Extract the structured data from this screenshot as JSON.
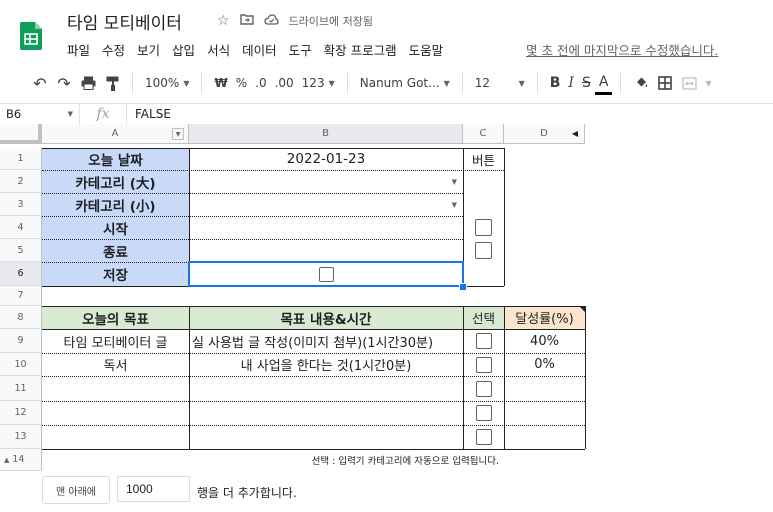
{
  "doc": {
    "title": "타임 모티베이터",
    "drive_status": "드라이브에 저장됨",
    "last_edit": "몇 초 전에 마지막으로 수정했습니다."
  },
  "menu": [
    "파일",
    "수정",
    "보기",
    "삽입",
    "서식",
    "데이터",
    "도구",
    "확장 프로그램",
    "도움말"
  ],
  "toolbar": {
    "zoom": "100%",
    "currency": "₩",
    "percent": "%",
    "decimal_less": ".0",
    "decimal_more": ".00",
    "format_more": "123",
    "font": "Nanum Got...",
    "font_size": "12",
    "bold": "B",
    "italic": "I",
    "strike": "S",
    "text_color": "A"
  },
  "formula_bar": {
    "cell_ref": "B6",
    "fx": "fx",
    "value": "FALSE"
  },
  "columns": [
    "A",
    "B",
    "C",
    "D"
  ],
  "rows": [
    "1",
    "2",
    "3",
    "4",
    "5",
    "6",
    "7",
    "8",
    "9",
    "10",
    "11",
    "12",
    "13",
    "14"
  ],
  "sheet": {
    "a1": "오늘 날짜",
    "b1": "2022-01-23",
    "c1": "버튼",
    "a2": "카테고리 (大)",
    "a3": "카테고리 (小)",
    "a4": "시작",
    "a5": "종료",
    "a6": "저장",
    "a8": "오늘의 목표",
    "b8": "목표 내용&시간",
    "c8": "선택",
    "d8": "달성률(%)",
    "a9": "타임 모티베이터 글",
    "b9": "실 사용법 글 작성(이미지 첨부)(1시간30분)",
    "d9": "40%",
    "a10": "독서",
    "b10": "내 사업을 한다는 것(1시간0분)",
    "d10": "0%",
    "note14": "선택 : 입력기 카테고리에 자동으로 입력됩니다."
  },
  "footer": {
    "add_button": "맨 아래에",
    "rows_value": "1000",
    "add_text": "행을 더 추가합니다."
  }
}
